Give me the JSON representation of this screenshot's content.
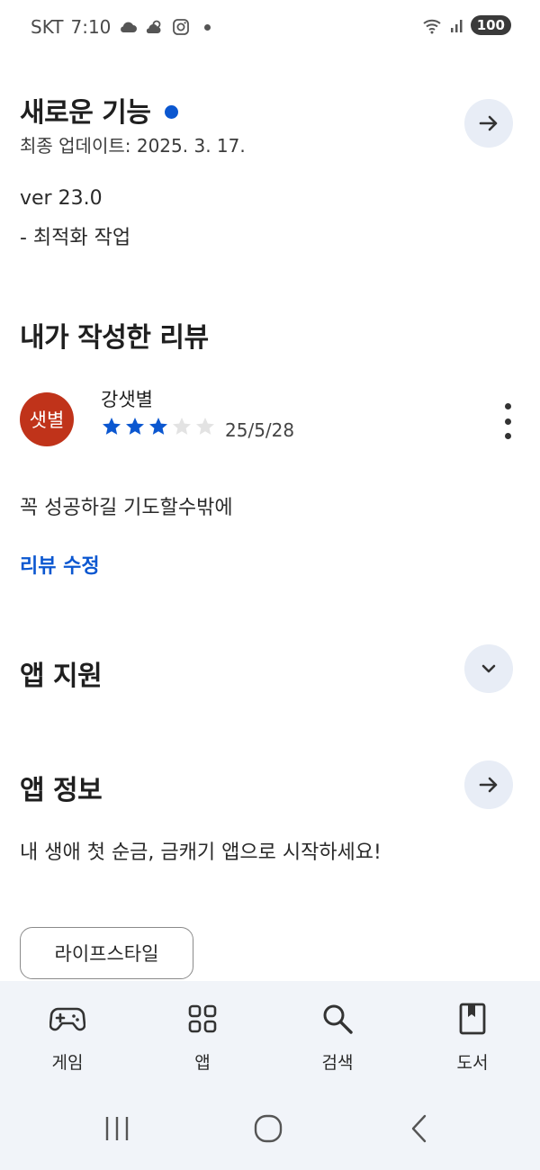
{
  "status_bar": {
    "carrier": "SKT",
    "time": "7:10",
    "battery": "100"
  },
  "whats_new": {
    "title": "새로운 기능",
    "updated": "최종 업데이트: 2025. 3. 17.",
    "version": "ver 23.0",
    "note": "- 최적화 작업"
  },
  "my_review": {
    "title": "내가 작성한 리뷰",
    "avatar_text": "샛별",
    "reviewer_name": "강샛별",
    "rating": 3,
    "rating_max": 5,
    "date": "25/5/28",
    "text": "꼭 성공하길 기도할수밖에",
    "edit_label": "리뷰 수정"
  },
  "app_support": {
    "title": "앱 지원"
  },
  "app_info": {
    "title": "앱 정보",
    "description": "내 생애 첫 순금, 금캐기 앱으로 시작하세요!",
    "category_chip": "라이프스타일"
  },
  "bottom_nav": {
    "items": [
      {
        "label": "게임",
        "icon": "gamepad-icon"
      },
      {
        "label": "앱",
        "icon": "apps-grid-icon"
      },
      {
        "label": "검색",
        "icon": "search-icon"
      },
      {
        "label": "도서",
        "icon": "book-icon"
      }
    ]
  },
  "colors": {
    "accent": "#0b57d0",
    "avatar_bg": "#c0331a",
    "button_bg": "#e8edf6",
    "nav_bg": "#f1f4f9"
  }
}
